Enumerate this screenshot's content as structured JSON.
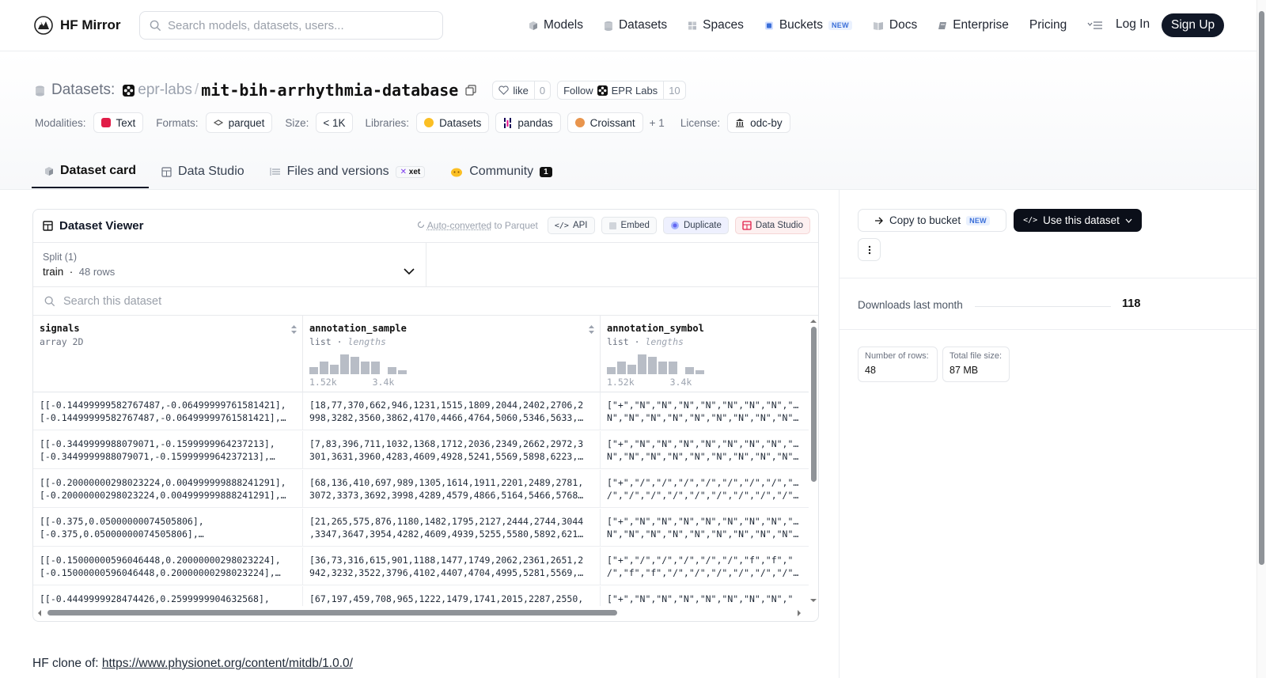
{
  "topnav": {
    "brand": "HF Mirror",
    "search_placeholder": "Search models, datasets, users...",
    "links": [
      "Models",
      "Datasets",
      "Spaces",
      "Buckets",
      "Docs",
      "Enterprise",
      "Pricing"
    ],
    "buckets_badge": "NEW",
    "login": "Log In",
    "signup": "Sign Up"
  },
  "repo": {
    "type_label": "Datasets:",
    "org": "epr-labs",
    "sep": "/",
    "name": "mit-bih-arrhythmia-database",
    "like_label": "like",
    "like_count": "0",
    "follow_label": "Follow",
    "follow_org": "EPR Labs",
    "follow_count": "10"
  },
  "tags": {
    "modalities_key": "Modalities:",
    "modality": "Text",
    "formats_key": "Formats:",
    "format": "parquet",
    "size_key": "Size:",
    "size": "< 1K",
    "libraries_key": "Libraries:",
    "libraries": [
      "Datasets",
      "pandas",
      "Croissant"
    ],
    "more": "+ 1",
    "license_key": "License:",
    "license": "odc-by"
  },
  "tabs": {
    "card": "Dataset card",
    "studio": "Data Studio",
    "files": "Files and versions",
    "xet": "xet",
    "community": "Community",
    "community_count": "1"
  },
  "viewer": {
    "title": "Dataset Viewer",
    "autoconv_link": "Auto-converted",
    "autoconv_rest": "to Parquet",
    "btn_api": "API",
    "btn_embed": "Embed",
    "btn_duplicate": "Duplicate",
    "btn_studio": "Data Studio",
    "split_label": "Split (1)",
    "split_name": "train",
    "split_rows": "48 rows",
    "search_placeholder": "Search this dataset",
    "columns": [
      {
        "name": "signals",
        "type": "array 2D",
        "sub": ""
      },
      {
        "name": "annotation_sample",
        "type": "list",
        "sub": "lengths",
        "hist_min": "1.52k",
        "hist_max": "3.4k"
      },
      {
        "name": "annotation_symbol",
        "type": "list",
        "sub": "lengths",
        "hist_min": "1.52k",
        "hist_max": "3.4k"
      }
    ],
    "hist_values": [
      0.35,
      0.6,
      0.45,
      0.95,
      0.85,
      0.6,
      0.6,
      0,
      0.35,
      0.2
    ],
    "rows": [
      [
        "[[-0.14499999582767487,-0.06499999761581421],",
        "[-0.14499999582767487,-0.06499999761581421],…",
        "[18,77,370,662,946,1231,1515,1809,2044,2402,2706,2",
        "998,3282,3560,3862,4170,4466,4764,5060,5346,5633,…",
        "[\"+\",\"N\",\"N\",\"N\",\"N\",\"N\",\"N\",\"N\",\"N\",\"",
        "N\",\"N\",\"N\",\"N\",\"N\",\"N\",\"N\",\"N\",\"N\",\"N\""
      ],
      [
        "[[-0.3449999988079071,-0.1599999964237213],",
        "[-0.3449999988079071,-0.1599999964237213],…",
        "[7,83,396,711,1032,1368,1712,2036,2349,2662,2972,3",
        "301,3631,3960,4283,4609,4928,5241,5569,5898,6223,…",
        "[\"+\",\"N\",\"N\",\"N\",\"N\",\"N\",\"N\",\"N\",\"N\",\"",
        "N\",\"N\",\"N\",\"N\",\"N\",\"N\",\"N\",\"N\",\"N\",\"N\""
      ],
      [
        "[[-0.20000000298023224,0.004999999888241291],",
        "[-0.20000000298023224,0.004999999888241291],…",
        "[68,136,410,697,989,1305,1614,1911,2201,2489,2781,",
        "3072,3373,3692,3998,4289,4579,4866,5164,5466,5768…",
        "[\"+\",\"/\",\"/\",\"/\",\"/\",\"/\",\"/\",\"/\",\"/\",\"",
        "/\",\"/\",\"/\",\"/\",\"/\",\"/\",\"/\",\"/\",\"/\",\"/\""
      ],
      [
        "[[-0.375,0.05000000074505806],",
        "[-0.375,0.05000000074505806],…",
        "[21,265,575,876,1180,1482,1795,2127,2444,2744,3044",
        ",3347,3647,3954,4282,4609,4939,5255,5580,5892,621…",
        "[\"+\",\"N\",\"N\",\"N\",\"N\",\"N\",\"N\",\"N\",\"N\",\"",
        "N\",\"N\",\"N\",\"N\",\"N\",\"N\",\"N\",\"N\",\"N\",\"N\""
      ],
      [
        "[[-0.15000000596046448,0.20000000298023224],",
        "[-0.15000000596046448,0.20000000298023224],…",
        "[36,73,316,615,901,1188,1477,1749,2062,2361,2651,2",
        "942,3232,3522,3796,4102,4407,4704,4995,5281,5569,…",
        "[\"+\",\"/\",\"/\",\"/\",\"/\",\"/\",\"f\",\"f\",\"",
        "/\",\"f\",\"f\",\"/\",\"/\",\"/\",\"/\",\"/\",\"/\",\"f\""
      ],
      [
        "[[-0.4449999928474426,0.2599999904632568],",
        "",
        "[67,197,459,708,965,1222,1479,1741,2015,2287,2550,",
        "",
        "[\"+\",\"N\",\"N\",\"N\",\"N\",\"N\",\"N\",\"N\",\"",
        ""
      ]
    ]
  },
  "sidebar": {
    "copy_bucket": "Copy to bucket",
    "copy_badge": "NEW",
    "use_dataset": "Use this dataset",
    "downloads_label": "Downloads last month",
    "downloads": "118",
    "rows_label": "Number of rows:",
    "rows_value": "48",
    "size_label": "Total file size:",
    "size_value": "87 MB"
  },
  "clone": {
    "prefix": "HF clone of:",
    "url": "https://www.physionet.org/content/mitdb/1.0.0/"
  }
}
